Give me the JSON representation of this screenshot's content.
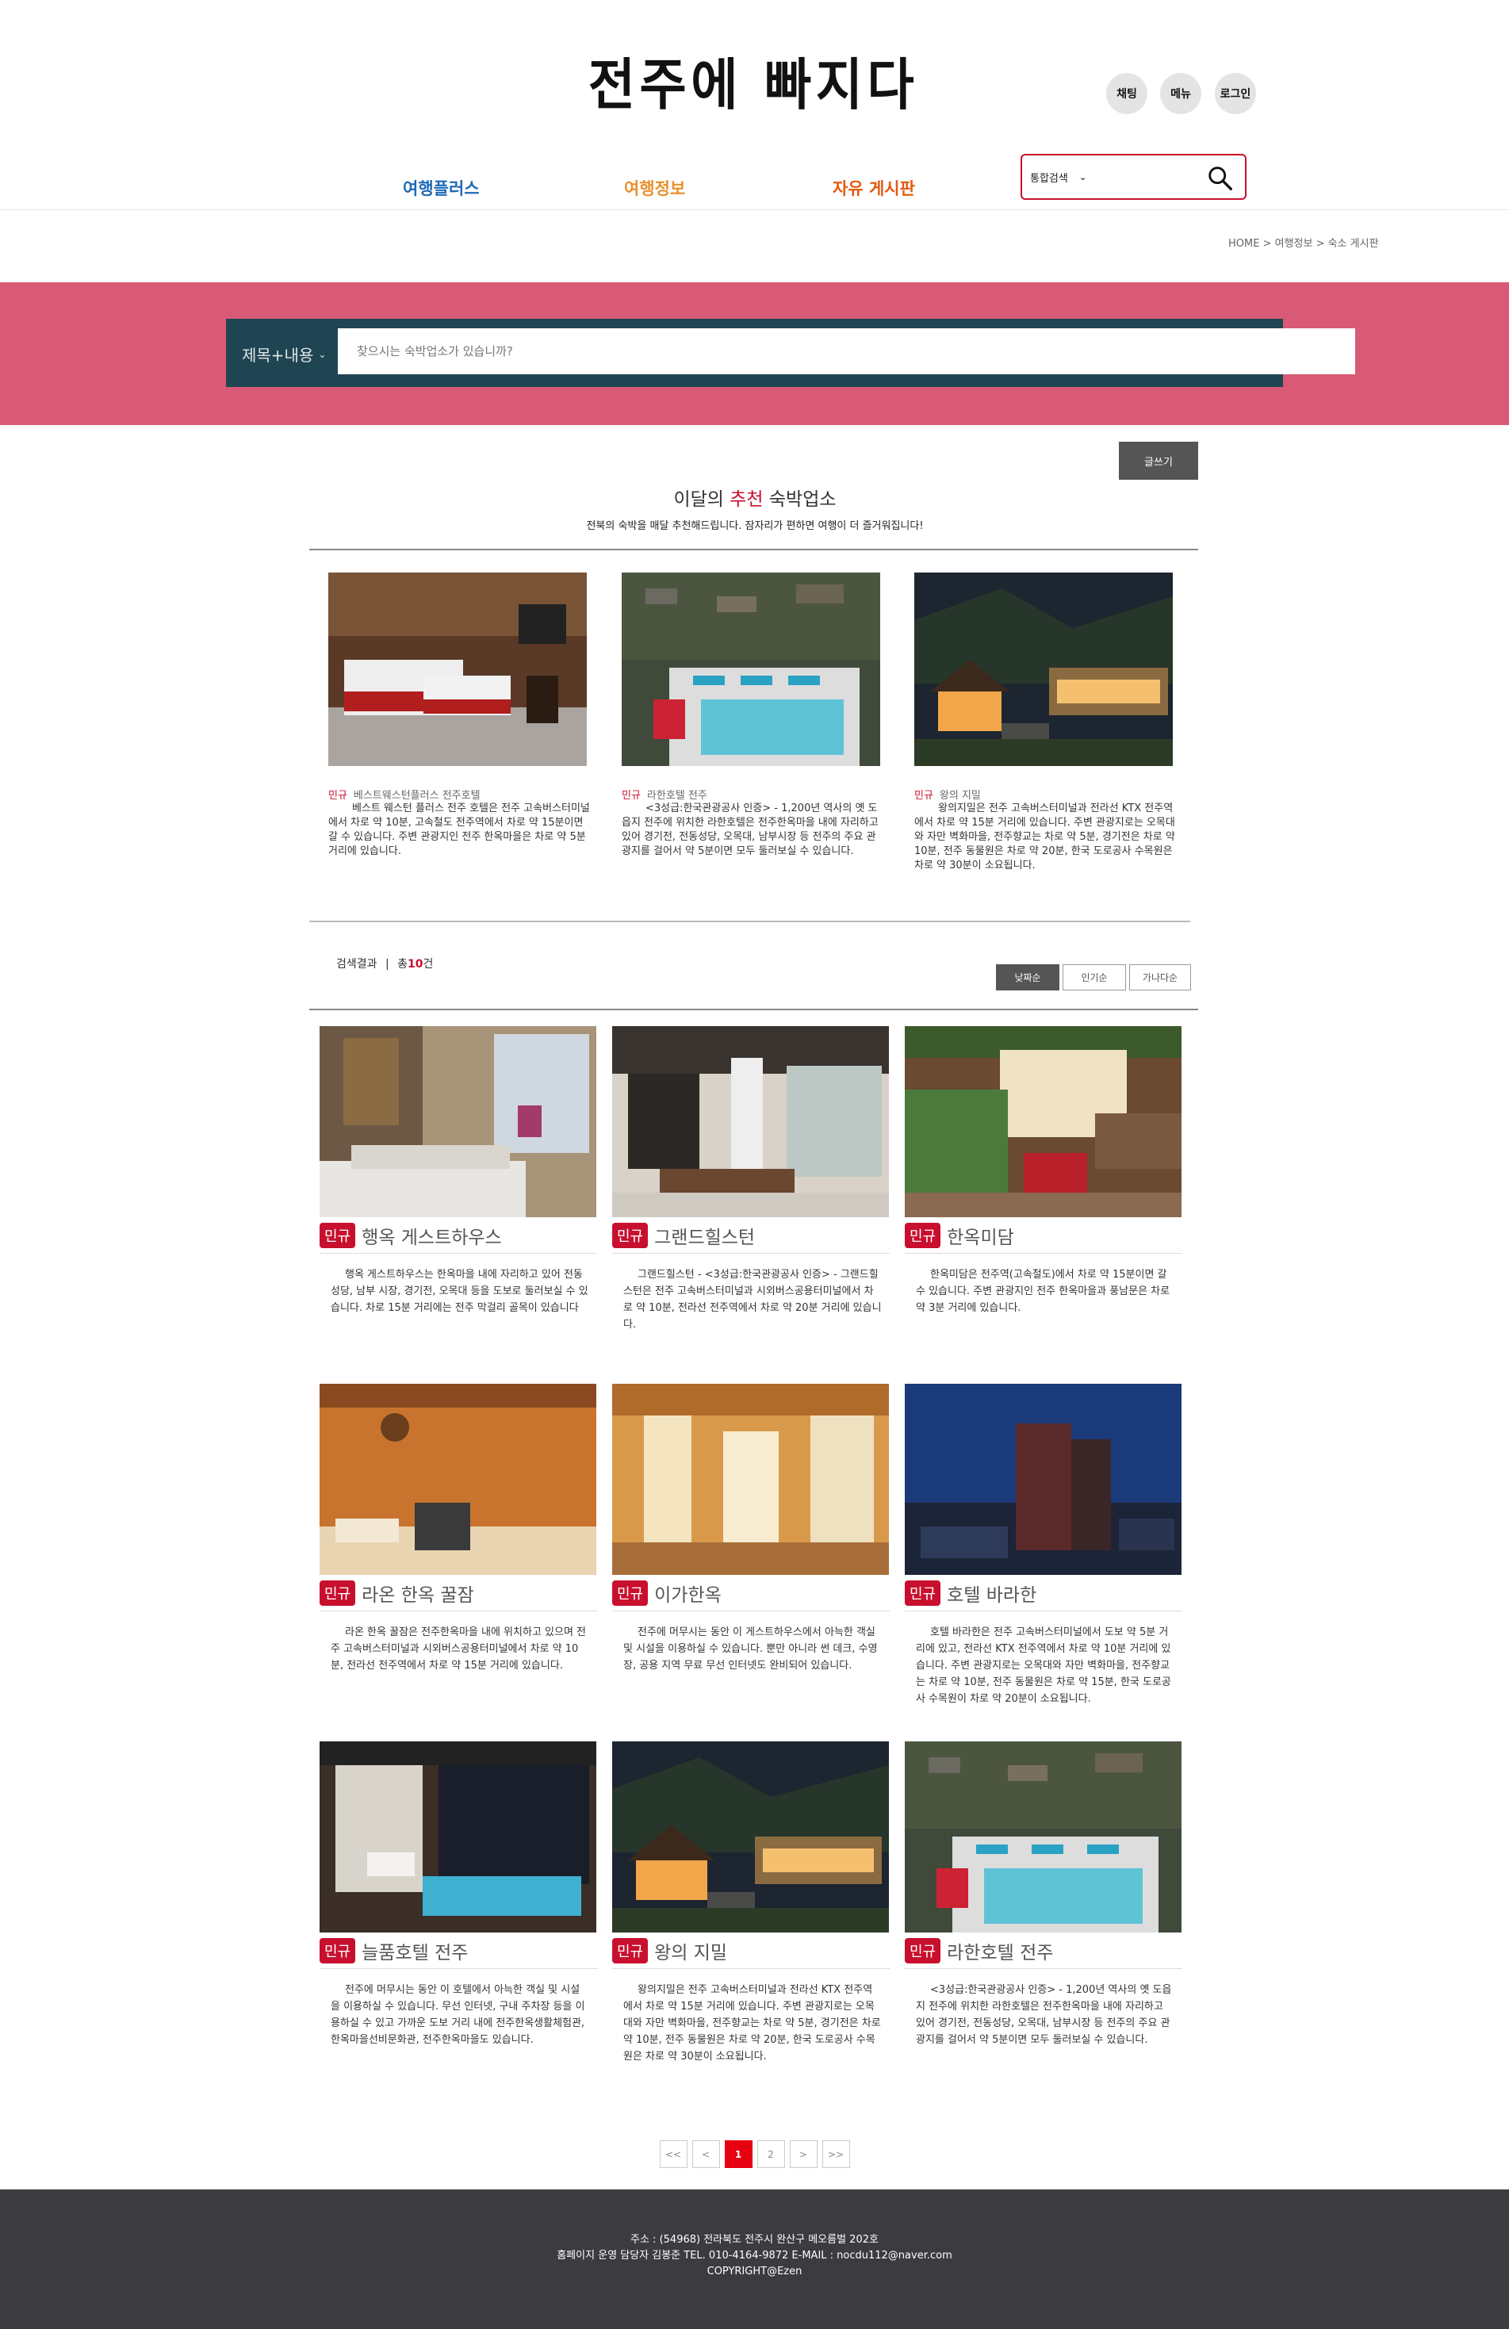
{
  "site": {
    "title": "전주에 빠지다"
  },
  "header": {
    "chat_label": "채팅",
    "menu_label": "메뉴",
    "login_label": "로그인",
    "nav": [
      {
        "label": "여행플러스",
        "color": "#1e6ab8"
      },
      {
        "label": "여행정보",
        "color": "#e8912d"
      },
      {
        "label": "자유 게시판",
        "color": "#e45a12"
      }
    ],
    "search_select": "통합검색"
  },
  "breadcrumb": "HOME > 여행정보 > 숙소 게시판",
  "banner_search": {
    "select": "제목+내용",
    "placeholder": "찾으시는 숙박업소가 있습니까?"
  },
  "write_button": "글쓰기",
  "recommend": {
    "title_pre": "이달의",
    "title_hl": "추천",
    "title_post": "숙박업소",
    "subtitle": "전북의 숙박을 매달 추천해드립니다. 잠자리가 편하면 여행이 더 즐거워집니다!",
    "items": [
      {
        "tag": "민규",
        "name": "베스트웨스턴플러스 전주호텔",
        "desc": "베스트 웨스턴 플러스 전주 호텔은 전주 고속버스터미널에서 차로 약 10분, 고속철도 전주역에서 차로 약 15분이면 갈 수 있습니다. 주변 관광지인 전주 한옥마을은 차로 약 5분 거리에 있습니다.",
        "image": "hotel-room-photo"
      },
      {
        "tag": "민규",
        "name": "라한호텔 전주",
        "desc": "<3성급:한국관광공사 인증> - 1,200년 역사의 옛 도읍지 전주에 위치한 라한호텔은 전주한옥마을 내에 자리하고 있어 경기전, 전동성당, 오목대, 남부시장 등 전주의 주요 관광지를 걸어서 약 5분이면 모두 둘러보실 수 있습니다.",
        "image": "rooftop-pool-photo"
      },
      {
        "tag": "민규",
        "name": "왕의 지밀",
        "desc": "왕의지밀은 전주 고속버스터미널과 전라선 KTX 전주역에서 차로 약 15분 거리에 있습니다. 주변 관광지로는 오목대와 자만 벽화마을, 전주향교는 차로 약 5분, 경기전은 차로 약 10분, 전주 동물원은 차로 약 20분, 한국 도로공사 수목원은 차로 약 30분이 소요됩니다.",
        "image": "hanok-night-photo"
      }
    ]
  },
  "results": {
    "label": "검색결과",
    "sep": "|",
    "count_pre": "총",
    "count": "10",
    "count_post": "건"
  },
  "sort": [
    "낮짜순",
    "인기순",
    "가나다순"
  ],
  "list": [
    {
      "badge": "민규",
      "name": "행옥 게스트하우스",
      "desc": "행옥 게스트하우스는 한옥마을 내에 자리하고 있어 전동성당, 남부 시장, 경기전, 오목대 등을 도보로 둘러보실 수 있습니다. 차로 15분 거리에는 전주 막걸리 골목이 있습니다",
      "image": "guesthouse-room-photo"
    },
    {
      "badge": "민규",
      "name": "그랜드힐스턴",
      "desc": "그랜드힐스턴 - <3성급:한국관광공사 인증> - 그랜드힐스턴은 전주 고속버스터미널과 시외버스공용터미널에서 차로 약 10분, 전라선 전주역에서 차로 약 20분 거리에 있습니다.",
      "image": "modern-lobby-photo"
    },
    {
      "badge": "민규",
      "name": "한옥미담",
      "desc": "한옥미담은 전주역(고속철도)에서 차로 약 15분이면 갈 수 있습니다. 주변 관광지인 전주 한옥마을과 풍남문은 차로 약 3분 거리에 있습니다.",
      "image": "hanok-garden-photo"
    },
    {
      "badge": "민규",
      "name": "라온 한옥 꿀잠",
      "desc": "라온 한옥 꿀잠은 전주한옥마을 내에 위치하고 있으며 전주 고속버스터미널과 시외버스공용터미널에서 차로 약 10분, 전라선 전주역에서 차로 약 15분 거리에 있습니다.",
      "image": "hanok-room-photo"
    },
    {
      "badge": "민규",
      "name": "이가한옥",
      "desc": "전주에 머무시는 동안 이 게스트하우스에서 아늑한 객실 및 시설을 이용하실 수 있습니다. 뿐만 아니라 썬 데크, 수영장, 공용 지역 무료 무선 인터넷도 완비되어 있습니다.",
      "image": "hanok-corridor-photo"
    },
    {
      "badge": "민규",
      "name": "호텔 바라한",
      "desc": "호텔 바라한은 전주 고속버스터미널에서 도보 약 5분 거리에 있고, 전라선 KTX 전주역에서 차로 약 10분 거리에 있습니다. 주변 관광지로는 오목대와 자만 벽화마을, 전주향교는 차로 약 10분, 전주 동물원은 차로 약 15분, 한국 도로공사 수목원이 차로 약 20분이 소요됩니다.",
      "image": "hotel-tower-night-photo"
    },
    {
      "badge": "민규",
      "name": "늘품호텔 전주",
      "desc": "전주에 머무시는 동안 이 호텔에서 아늑한 객실 및 시설을 이용하실 수 있습니다. 무선 인터넷, 구내 주차장 등을 이용하실 수 있고 가까운 도보 거리 내에 전주한옥생활체험관, 한옥마을선비문화관, 전주한옥마을도 있습니다.",
      "image": "hotel-spa-room-photo"
    },
    {
      "badge": "민규",
      "name": "왕의 지밀",
      "desc": "왕의지밀은 전주 고속버스터미널과 전라선 KTX 전주역에서 차로 약 15분 거리에 있습니다. 주변 관광지로는 오목대와 자만 벽화마을, 전주향교는 차로 약 5분, 경기전은 차로 약 10분, 전주 동물원은 차로 약 20분, 한국 도로공사 수목원은 차로 약 30분이 소요됩니다.",
      "image": "hanok-night-photo"
    },
    {
      "badge": "민규",
      "name": "라한호텔 전주",
      "desc": "<3성급:한국관광공사 인증> - 1,200년 역사의 옛 도읍지 전주에 위치한 라한호텔은 전주한옥마을 내에 자리하고 있어 경기전, 전동성당, 오목대, 남부시장 등 전주의 주요 관광지를 걸어서 약 5분이면 모두 둘러보실 수 있습니다.",
      "image": "rooftop-pool-photo"
    }
  ],
  "pagination": [
    "<<",
    "<",
    "1",
    "2",
    ">",
    ">>"
  ],
  "footer": {
    "line1": "주소 : (54968) 전라북도 전주시 완산구 메오름벌 202호",
    "line2": "홈페이지 운영 담당자 김봉준 TEL. 010-4164-9872 E-MAIL : nocdu112@naver.com",
    "line3": "COPYRIGHT@Ezen"
  },
  "colors": {
    "brand_red": "#c8102e",
    "banner_pink": "#d85a76",
    "banner_search": "#1f4552",
    "footer": "#3c3b3f"
  }
}
